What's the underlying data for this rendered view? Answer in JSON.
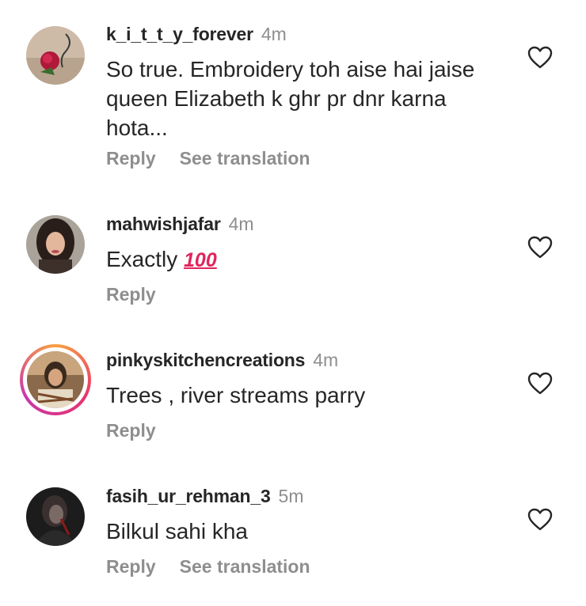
{
  "comments": [
    {
      "username": "k_i_t_t_y_forever",
      "time": "4m",
      "text": "So true. Embroidery toh aise hai jaise queen Elizabeth k ghr pr dnr karna hota...",
      "emoji": "",
      "reply_label": "Reply",
      "translation_label": "See translation",
      "avatar_icon": "rose-photo-avatar"
    },
    {
      "username": "mahwishjafar",
      "time": "4m",
      "text": "Exactly ",
      "emoji": "100",
      "reply_label": "Reply",
      "translation_label": "",
      "avatar_icon": "woman-photo-avatar"
    },
    {
      "username": "pinkyskitchencreations",
      "time": "4m",
      "text": "Trees , river streams  parry",
      "emoji": "",
      "reply_label": "Reply",
      "translation_label": "",
      "avatar_icon": "story-ring-avatar"
    },
    {
      "username": "fasih_ur_rehman_3",
      "time": "5m",
      "text": "Bilkul sahi kha",
      "emoji": "",
      "reply_label": "Reply",
      "translation_label": "See translation",
      "avatar_icon": "dark-photo-avatar"
    }
  ],
  "colors": {
    "username": "#262626",
    "secondary": "#8e8e8e",
    "story_ring": [
      "#f9a03f",
      "#e8346b",
      "#c837ab"
    ],
    "emoji_100": "#e0245e"
  },
  "icons": {
    "like": "heart-outline-icon"
  }
}
